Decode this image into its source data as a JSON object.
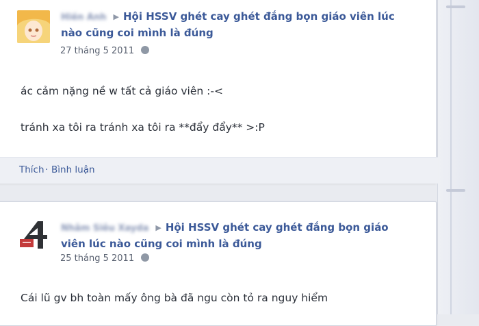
{
  "colors": {
    "link": "#3b5998",
    "background": "#e9ebf0",
    "text": "#2a2f38"
  },
  "posts": [
    {
      "author": "Hiền Anh",
      "group": "Hội HSSV ghét cay ghét đắng bọn giáo viên lúc nào cũng coi mình là đúng",
      "date": "27 tháng 5 2011",
      "lines": [
        "ác cảm nặng nề w tất cả giáo viên :-<",
        "tránh xa tôi ra tránh xa tôi ra **đẩy đẩy** >:P"
      ],
      "actions": {
        "like": "Thích",
        "separator": "·",
        "comment": "Bình luận"
      },
      "avatar_icon": "user-avatar-icon"
    },
    {
      "author": "Nhâm Siêu Xayda",
      "group": "Hội HSSV ghét cay ghét đắng bọn giáo viên lúc nào cũng coi mình là đúng",
      "date": "25 tháng 5 2011",
      "lines": [
        "Cái lũ gv bh toàn mấy ông bà đã ngu còn tỏ ra nguy hiểm"
      ],
      "avatar_icon": "user-avatar-icon"
    }
  ]
}
